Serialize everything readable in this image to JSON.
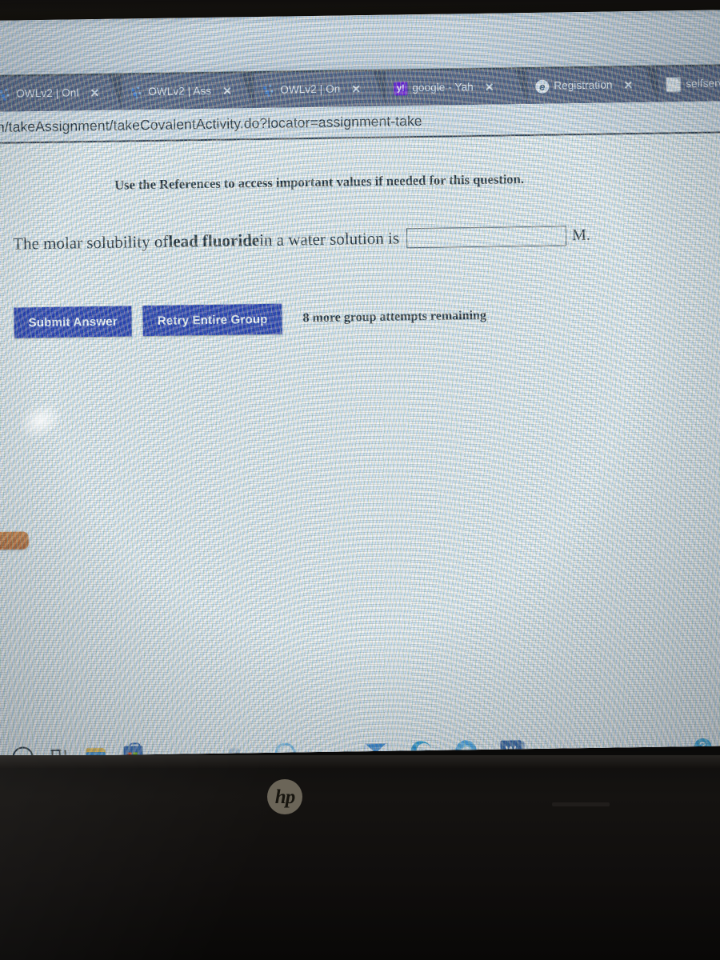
{
  "browser": {
    "tabs": [
      {
        "label": "OWLv2 | Onl",
        "favicon": "owl-dots-icon",
        "close": "✕"
      },
      {
        "label": "OWLv2 | Ass",
        "favicon": "owl-dots-icon",
        "close": "✕"
      },
      {
        "label": "OWLv2 | On",
        "favicon": "owl-dots-icon",
        "close": "✕"
      },
      {
        "label": "google - Yah",
        "favicon": "yahoo-icon",
        "favicon_text": "y!",
        "close": "✕"
      },
      {
        "label": "Registration",
        "favicon": "edge-icon",
        "favicon_text": "e",
        "close": "✕"
      },
      {
        "label": "selfserve.un",
        "favicon": "document-icon",
        "close": "✕"
      }
    ],
    "url": "rn/takeAssignment/takeCovalentActivity.do?locator=assignment-take"
  },
  "page": {
    "references_note": "Use the References to access important values if needed for this question.",
    "question": {
      "prefix": "The molar solubility of ",
      "substance": "lead fluoride",
      "suffix": " in a water solution is",
      "answer_value": "",
      "answer_placeholder": "",
      "unit": "M."
    },
    "buttons": {
      "submit": "Submit Answer",
      "retry": "Retry Entire Group"
    },
    "attempts_text": "8 more group attempts remaining"
  },
  "taskbar": {
    "items": [
      {
        "name": "cortana-icon"
      },
      {
        "name": "task-view-icon"
      },
      {
        "name": "file-explorer-icon"
      },
      {
        "name": "microsoft-store-icon"
      },
      {
        "name": "faint-app-icon"
      },
      {
        "name": "ring-app-icon"
      },
      {
        "name": "mail-icon"
      },
      {
        "name": "edge-icon"
      },
      {
        "name": "chrome-icon"
      },
      {
        "name": "word-icon",
        "label": "W"
      }
    ],
    "tray": {
      "help_label": "?",
      "chevron": "∧"
    }
  },
  "device": {
    "brand": "hp"
  },
  "colors": {
    "button_blue": "#1b2da8",
    "tabbar": "#353a52",
    "tab_active": "#4a5070",
    "page_bg": "#eef1f3",
    "side_tab_orange": "#d4762a"
  }
}
